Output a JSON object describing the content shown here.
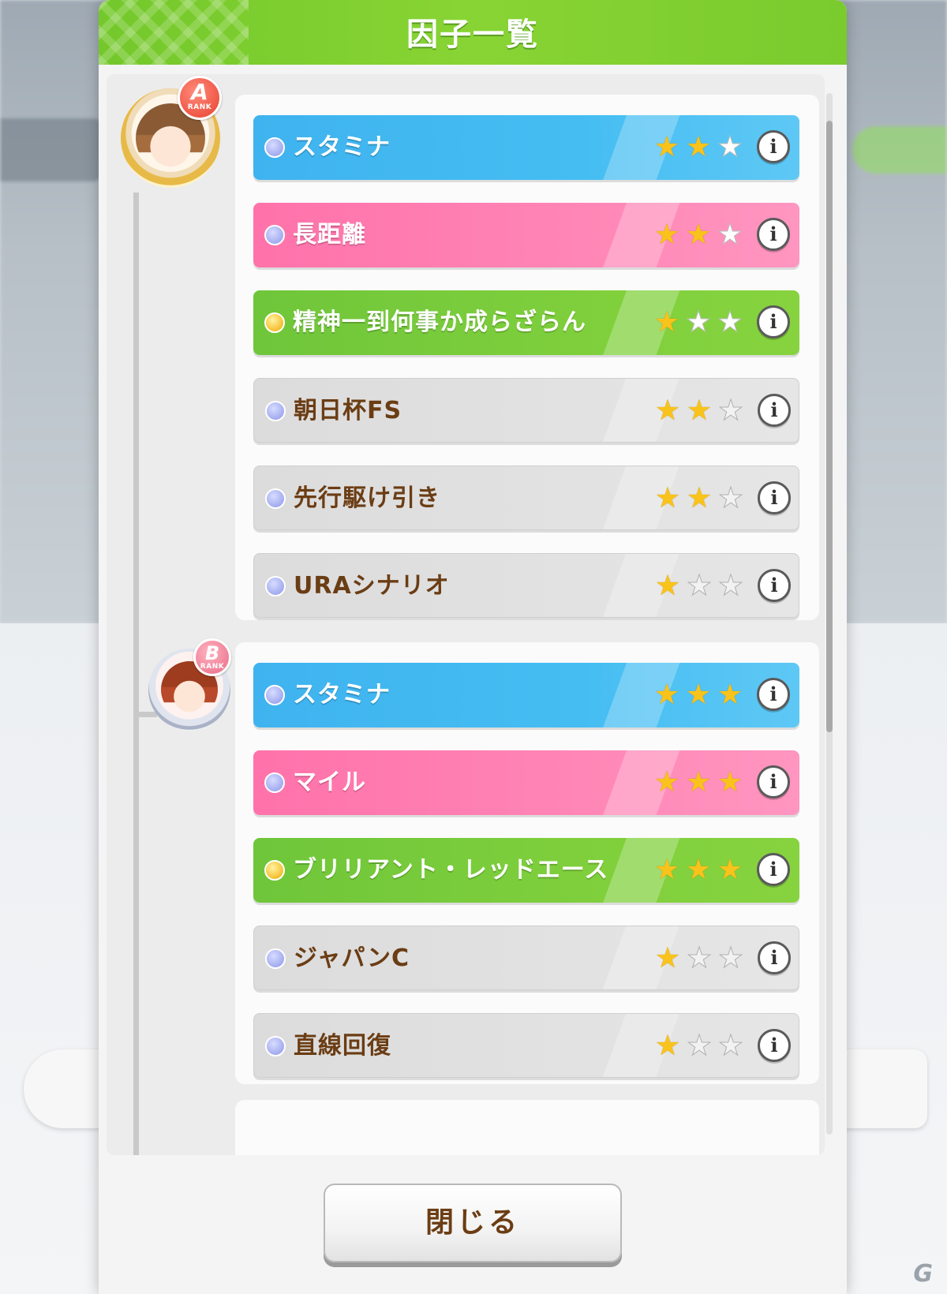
{
  "dialog": {
    "title": "因子一覧",
    "close_label": "閉じる"
  },
  "colors": {
    "header_green": "#7ccb2f",
    "factor_blue": "#45bdf2",
    "factor_pink": "#ff86b6",
    "factor_green": "#7fcf3c",
    "factor_gray": "#e2e2e2",
    "star_on": "#f9c31b",
    "label_brown": "#6b3d14"
  },
  "groups": [
    {
      "rank": {
        "letter": "A",
        "word": "RANK"
      },
      "avatar": "character-avatar-a",
      "factors": [
        {
          "label": "スタミナ",
          "color": "blue",
          "dot": "blue",
          "stars": 2,
          "max_stars": 3
        },
        {
          "label": "長距離",
          "color": "pink",
          "dot": "blue",
          "stars": 2,
          "max_stars": 3
        },
        {
          "label": "精神一到何事か成らざらん",
          "color": "green",
          "dot": "gold",
          "stars": 1,
          "max_stars": 3
        },
        {
          "label": "朝日杯FS",
          "color": "gray",
          "dot": "blue",
          "stars": 2,
          "max_stars": 3
        },
        {
          "label": "先行駆け引き",
          "color": "gray",
          "dot": "blue",
          "stars": 2,
          "max_stars": 3
        },
        {
          "label": "URAシナリオ",
          "color": "gray",
          "dot": "blue",
          "stars": 1,
          "max_stars": 3
        }
      ]
    },
    {
      "rank": {
        "letter": "B",
        "word": "RANK"
      },
      "avatar": "character-avatar-b",
      "factors": [
        {
          "label": "スタミナ",
          "color": "blue",
          "dot": "blue",
          "stars": 3,
          "max_stars": 3
        },
        {
          "label": "マイル",
          "color": "pink",
          "dot": "blue",
          "stars": 3,
          "max_stars": 3
        },
        {
          "label": "ブリリアント・レッドエース",
          "color": "green",
          "dot": "gold",
          "stars": 3,
          "max_stars": 3
        },
        {
          "label": "ジャパンC",
          "color": "gray",
          "dot": "blue",
          "stars": 1,
          "max_stars": 3
        },
        {
          "label": "直線回復",
          "color": "gray",
          "dot": "blue",
          "stars": 1,
          "max_stars": 3
        }
      ]
    }
  ],
  "icons": {
    "info": "i",
    "star": "★",
    "watermark": "G"
  }
}
